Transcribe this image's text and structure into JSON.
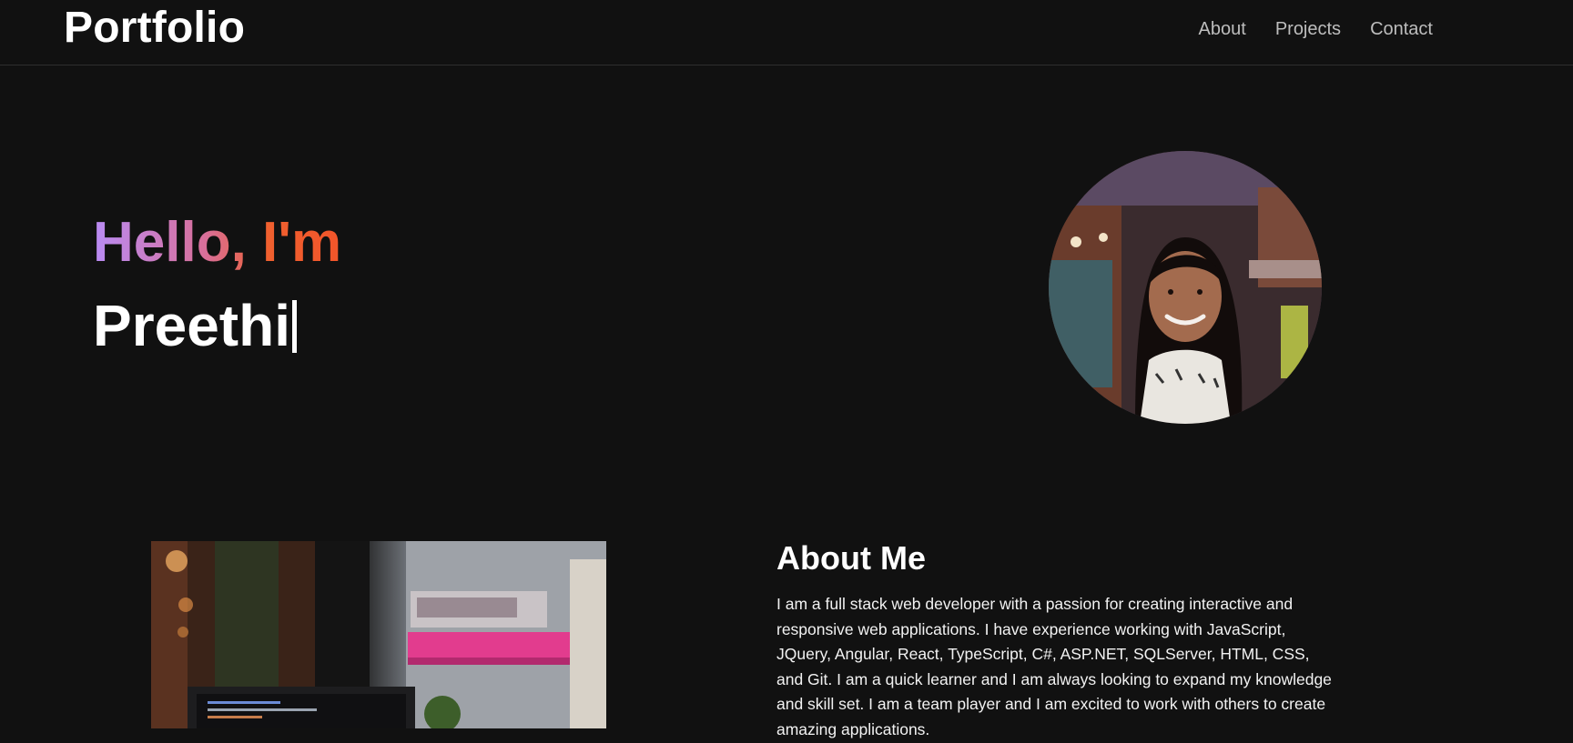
{
  "header": {
    "brand": "Portfolio",
    "nav": [
      {
        "label": "About"
      },
      {
        "label": "Projects"
      },
      {
        "label": "Contact"
      }
    ]
  },
  "hero": {
    "greeting": "Hello, I'm",
    "name": "Preethi",
    "gradient_colors": [
      "#b98cf5",
      "#d86f9a",
      "#f0602f"
    ]
  },
  "about": {
    "title": "About Me",
    "text": "I am a full stack web developer with a passion for creating interactive and responsive web applications. I have experience working with JavaScript, JQuery, Angular, React, TypeScript, C#, ASP.NET, SQLServer, HTML, CSS, and Git. I am a quick learner and I am always looking to expand my knowledge and skill set. I am a team player and I am excited to work with others to create amazing applications."
  },
  "colors": {
    "background": "#111111",
    "text": "#ffffff",
    "nav_text": "#bdbdbd"
  }
}
